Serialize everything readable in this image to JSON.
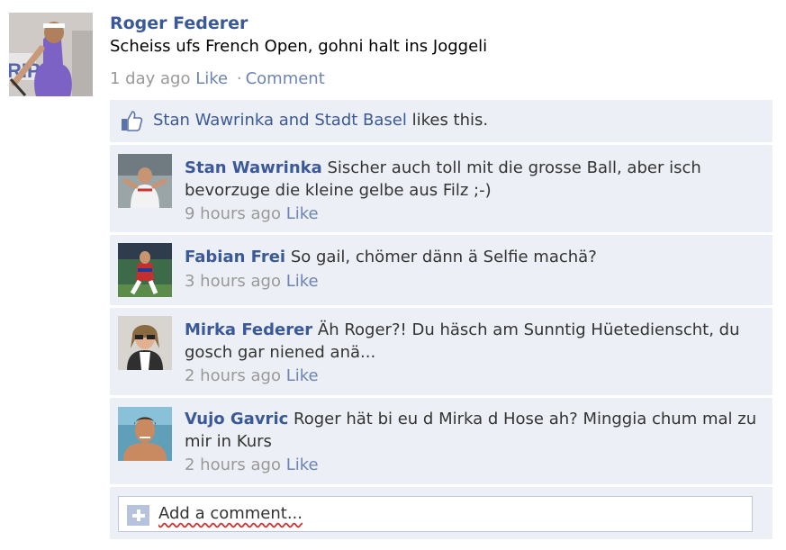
{
  "post": {
    "author": "Roger Federer",
    "text": "Scheiss ufs French Open, gohni halt ins Joggeli",
    "time": "1 day ago",
    "like_label": "Like",
    "separator": "·",
    "comment_label": "Comment"
  },
  "likes": {
    "name1": "Stan Wawrinka",
    "conj": " and ",
    "name2": "Stadt Basel",
    "suffix": " likes this."
  },
  "comments": [
    {
      "name": "Stan Wawrinka",
      "text": "Sischer auch toll mit die grosse Ball, aber isch bevorzuge die kleine gelbe aus Filz ;-)",
      "time": "9 hours ago",
      "like": "Like"
    },
    {
      "name": "Fabian Frei",
      "text": "So gail, chömer dänn ä Selfie machä?",
      "time": "3 hours ago",
      "like": "Like"
    },
    {
      "name": "Mirka Federer",
      "text": "Äh Roger?! Du häsch am Sunntig Hüetedienscht, du gosch gar niened anä...",
      "time": "2 hours ago",
      "like": "Like"
    },
    {
      "name": "Vujo Gavric",
      "text": "Roger hät bi eu d Mirka d Hose ah? Minggia chum mal zu mir in Kurs",
      "time": "2 hours ago",
      "like": "Like"
    }
  ],
  "add_comment": {
    "placeholder": "Add a comment..."
  },
  "colors": {
    "link": "#3b5998",
    "meta": "#999999",
    "box_bg": "#eceff5",
    "border": "#bdc7d8"
  },
  "icons": {
    "likes": "thumbs-up-icon",
    "add": "plus-icon"
  }
}
